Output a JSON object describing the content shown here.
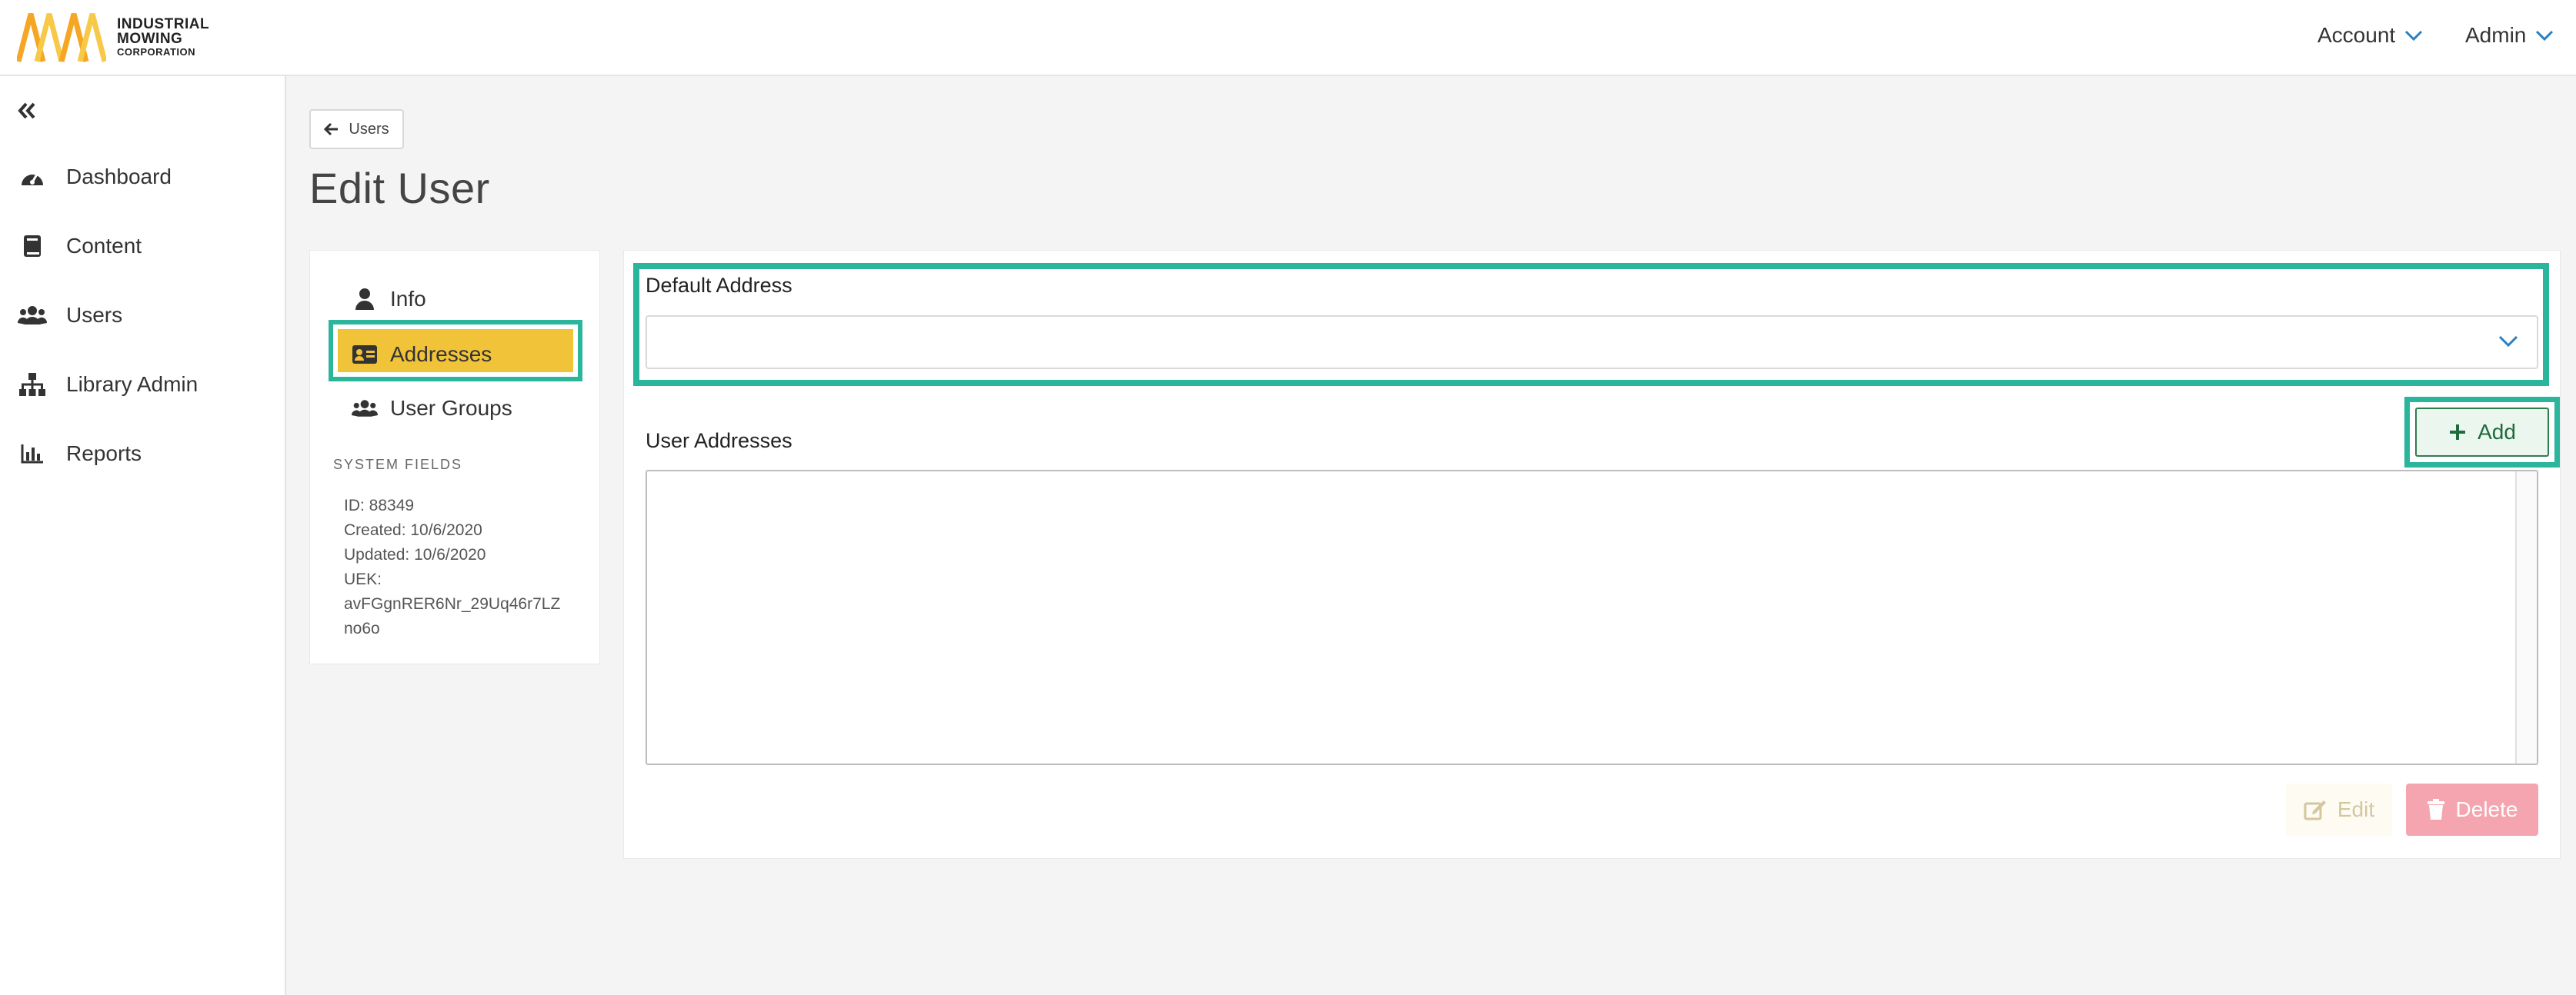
{
  "brand": {
    "line1": "INDUSTRIAL",
    "line2": "MOWING",
    "line3": "CORPORATION",
    "logo_colors": [
      "#f5a623",
      "#f7c948"
    ]
  },
  "header": {
    "account_label": "Account",
    "admin_label": "Admin",
    "chevron_color": "#2a7fc1"
  },
  "sidebar": {
    "collapse_icon": "double-chevron-left-icon",
    "items": [
      {
        "label": "Dashboard",
        "icon": "dashboard-gauge-icon"
      },
      {
        "label": "Content",
        "icon": "book-icon"
      },
      {
        "label": "Users",
        "icon": "users-icon"
      },
      {
        "label": "Library Admin",
        "icon": "sitemap-icon"
      },
      {
        "label": "Reports",
        "icon": "bar-chart-icon"
      }
    ]
  },
  "main": {
    "back_label": "Users",
    "title": "Edit User"
  },
  "user_nav": {
    "items": [
      {
        "label": "Info",
        "icon": "user-icon"
      },
      {
        "label": "Addresses",
        "icon": "address-card-icon",
        "active": true
      },
      {
        "label": "User Groups",
        "icon": "users-icon"
      }
    ],
    "active_color": "#f1c338",
    "highlight_color": "#2bb59c"
  },
  "system_fields": {
    "title": "SYSTEM FIELDS",
    "id_line": "ID: 88349",
    "created_line": "Created: 10/6/2020",
    "updated_line": "Updated: 10/6/2020",
    "uek_label": "UEK:",
    "uek_line1": "avFGgnRER6Nr_29Uq46r7LZ",
    "uek_line2": "no6o"
  },
  "addresses": {
    "default_label": "Default Address",
    "default_value": "",
    "user_addresses_label": "User Addresses",
    "add_label": "Add",
    "edit_label": "Edit",
    "delete_label": "Delete"
  }
}
